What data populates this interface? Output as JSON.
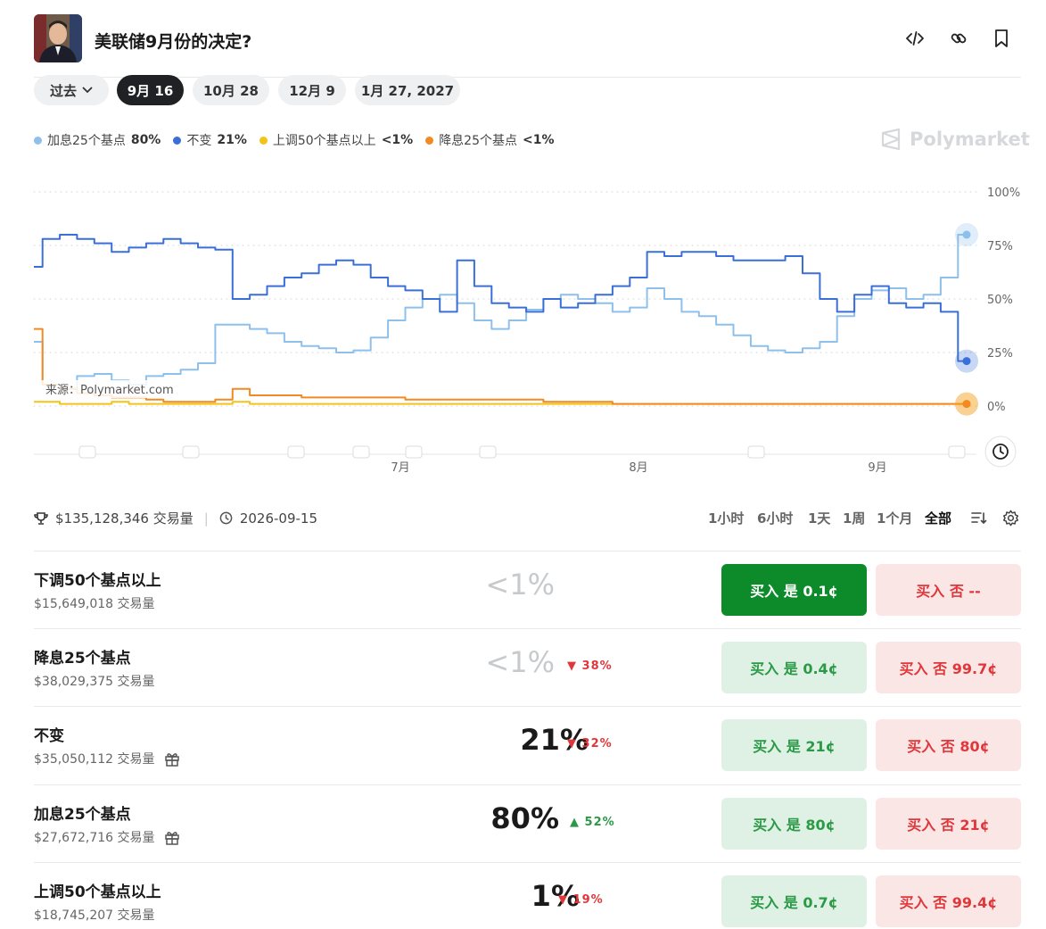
{
  "header": {
    "title": "美联储9月份的决定?"
  },
  "tabs": [
    "过去",
    "9月 16",
    "10月 28",
    "12月 9",
    "1月 27, 2027"
  ],
  "legend": [
    {
      "label": "加息25个基点",
      "value": "80%",
      "color": "#8ec0ec"
    },
    {
      "label": "不变",
      "value": "21%",
      "color": "#3b6fd8"
    },
    {
      "label": "上调50个基点以上",
      "value": "<1%",
      "color": "#f3c317"
    },
    {
      "label": "降息25个基点",
      "value": "<1%",
      "color": "#f28a22"
    }
  ],
  "brand": "Polymarket",
  "source_label": "来源：Polymarket.com",
  "chart_data": {
    "type": "line",
    "x_ticks": [
      "7月",
      "8月",
      "9月"
    ],
    "y_ticks": [
      "100%",
      "75%",
      "50%",
      "25%",
      "0%"
    ],
    "ylim": [
      0,
      100
    ],
    "series": [
      {
        "name": "加息25个基点",
        "color": "#8ec0ec",
        "values": [
          30,
          10,
          8,
          14,
          15,
          12,
          10,
          14,
          15,
          17,
          20,
          38,
          38,
          36,
          34,
          30,
          28,
          27,
          25,
          26,
          32,
          40,
          46,
          50,
          52,
          48,
          40,
          36,
          40,
          45,
          50,
          52,
          50,
          48,
          44,
          46,
          55,
          50,
          44,
          42,
          38,
          33,
          28,
          26,
          25,
          27,
          30,
          42,
          50,
          54,
          55,
          50,
          52,
          60,
          80
        ]
      },
      {
        "name": "不变",
        "color": "#3b6fd8",
        "values": [
          65,
          78,
          80,
          78,
          76,
          72,
          74,
          76,
          78,
          76,
          74,
          73,
          50,
          52,
          56,
          60,
          62,
          66,
          68,
          66,
          60,
          56,
          54,
          50,
          44,
          68,
          56,
          48,
          46,
          44,
          50,
          46,
          48,
          52,
          56,
          60,
          72,
          70,
          72,
          72,
          70,
          68,
          68,
          68,
          70,
          62,
          50,
          44,
          52,
          56,
          48,
          46,
          48,
          44,
          21
        ]
      },
      {
        "name": "上调50个基点以上",
        "color": "#f3c317",
        "values": [
          2,
          2,
          1,
          1,
          1,
          2,
          1,
          1,
          1,
          1,
          1,
          1,
          2,
          1,
          1,
          1,
          1,
          1,
          1,
          1,
          1,
          1,
          1,
          1,
          1,
          1,
          1,
          1,
          1,
          1,
          1,
          1,
          1,
          1,
          1,
          1,
          1,
          1,
          1,
          1,
          1,
          1,
          1,
          1,
          1,
          1,
          1,
          1,
          1,
          1,
          1,
          1,
          1,
          1,
          1
        ]
      },
      {
        "name": "降息25个基点",
        "color": "#f28a22",
        "values": [
          36,
          10,
          8,
          6,
          5,
          4,
          4,
          3,
          2,
          2,
          2,
          3,
          8,
          5,
          5,
          5,
          4,
          4,
          4,
          4,
          4,
          4,
          3,
          3,
          3,
          3,
          3,
          3,
          3,
          3,
          2,
          2,
          2,
          2,
          1,
          1,
          1,
          1,
          1,
          1,
          1,
          1,
          1,
          1,
          1,
          1,
          1,
          1,
          1,
          1,
          1,
          1,
          1,
          1,
          1
        ]
      }
    ]
  },
  "stats": {
    "volume": "$135,128,346 交易量",
    "date": "2026-09-15"
  },
  "ranges": [
    "1小时",
    "6小时",
    "1天",
    "1周",
    "1个月",
    "全部"
  ],
  "outcomes": [
    {
      "name": "下调50个基点以上",
      "volume": "$15,649,018 交易量",
      "pct": "<1%",
      "change": "",
      "yes": "买入 是 0.1¢",
      "no": "买入 否 --"
    },
    {
      "name": "降息25个基点",
      "volume": "$38,029,375 交易量",
      "pct": "<1%",
      "change": "38%",
      "yes": "买入 是 0.4¢",
      "no": "买入 否 99.7¢"
    },
    {
      "name": "不变",
      "volume": "$35,050,112 交易量",
      "pct": "21%",
      "change": "32%",
      "yes": "买入 是 21¢",
      "no": "买入 否 80¢"
    },
    {
      "name": "加息25个基点",
      "volume": "$27,672,716 交易量",
      "pct": "80%",
      "change": "52%",
      "yes": "买入 是 80¢",
      "no": "买入 否 21¢"
    },
    {
      "name": "上调50个基点以上",
      "volume": "$18,745,207 交易量",
      "pct": "1%",
      "change": "19%",
      "yes": "买入 是 0.7¢",
      "no": "买入 否 99.4¢"
    }
  ]
}
